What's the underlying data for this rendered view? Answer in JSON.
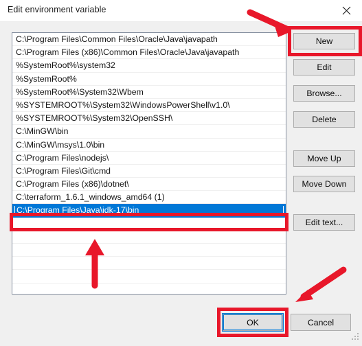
{
  "window": {
    "title": "Edit environment variable",
    "close_icon": "close-icon"
  },
  "list": {
    "selected_index": 13,
    "items": [
      "C:\\Program Files\\Common Files\\Oracle\\Java\\javapath",
      "C:\\Program Files (x86)\\Common Files\\Oracle\\Java\\javapath",
      "%SystemRoot%\\system32",
      "%SystemRoot%",
      "%SystemRoot%\\System32\\Wbem",
      "%SYSTEMROOT%\\System32\\WindowsPowerShell\\v1.0\\",
      "%SYSTEMROOT%\\System32\\OpenSSH\\",
      "C:\\MinGW\\bin",
      "C:\\MinGW\\msys\\1.0\\bin",
      "C:\\Program Files\\nodejs\\",
      "C:\\Program Files\\Git\\cmd",
      "C:\\Program Files (x86)\\dotnet\\",
      "C:\\terraform_1.6.1_windows_amd64 (1)",
      "C:\\Program Files\\Java\\jdk-17\\bin"
    ],
    "empty_row_count": 5
  },
  "side_buttons": [
    {
      "id": "new",
      "label": "New"
    },
    {
      "id": "edit",
      "label": "Edit"
    },
    {
      "id": "browse",
      "label": "Browse..."
    },
    {
      "id": "delete",
      "label": "Delete"
    },
    {
      "id": "move_up",
      "label": "Move Up"
    },
    {
      "id": "move_down",
      "label": "Move Down"
    },
    {
      "id": "edit_text",
      "label": "Edit text..."
    }
  ],
  "footer": {
    "ok_label": "OK",
    "cancel_label": "Cancel"
  },
  "annotations": {
    "highlight_color": "#e8172a",
    "boxes": [
      "new-button",
      "selected-list-row",
      "ok-button"
    ],
    "arrows": [
      "arrow-to-new-button",
      "arrow-to-selected-row",
      "arrow-to-ok-button"
    ]
  },
  "colors": {
    "selection_blue": "#0078d7",
    "dialog_background": "#f0f0f0",
    "button_face": "#e1e1e1",
    "annotation_red": "#e8172a"
  }
}
